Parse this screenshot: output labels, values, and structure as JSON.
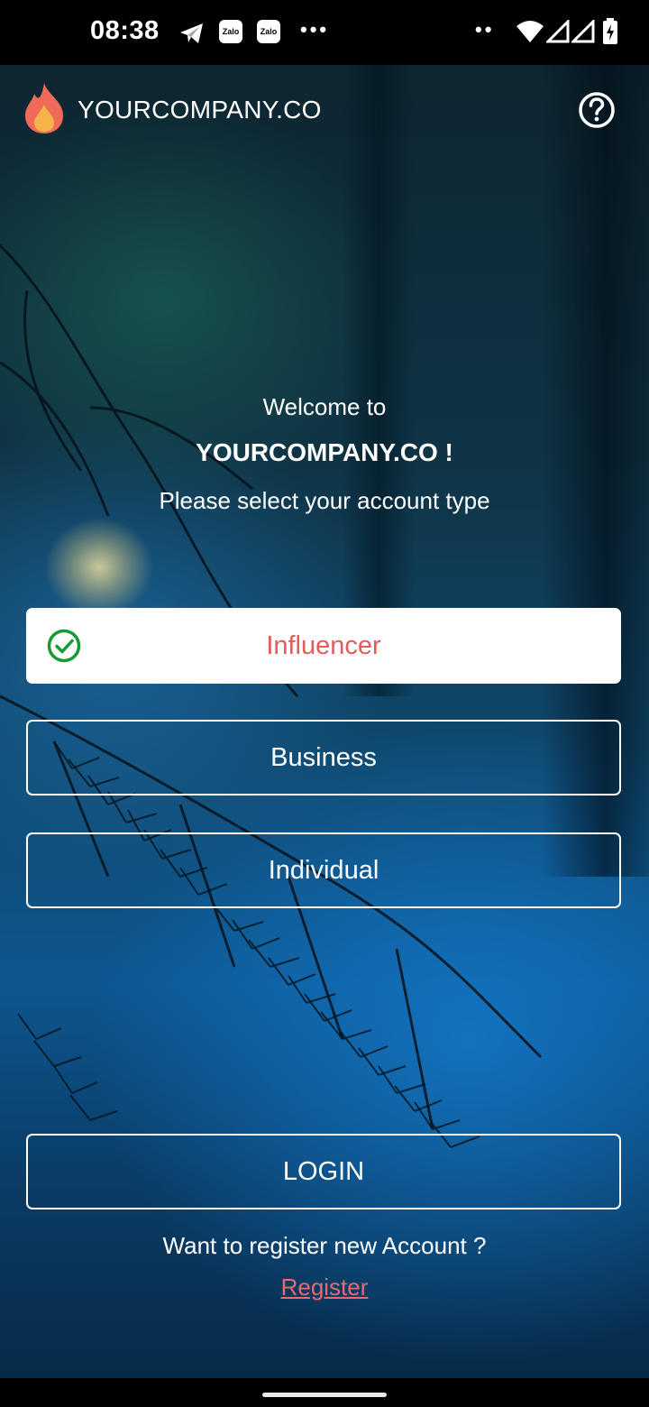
{
  "status_bar": {
    "time": "08:38",
    "notification_icons": [
      "telegram-icon",
      "zalo-icon",
      "zalo-icon",
      "more-dots-icon"
    ],
    "zalo_label": "Zalo",
    "system_icons": [
      "more-dots-icon",
      "wifi-icon",
      "signal-icon",
      "signal-icon",
      "battery-charging-icon"
    ]
  },
  "header": {
    "brand": "YOURCOMPANY.CO",
    "logo_icon": "flame-icon",
    "help_icon": "help-circle-icon"
  },
  "welcome": {
    "line1": "Welcome to",
    "line2": "YOURCOMPANY.CO !",
    "line3": "Please select your account type"
  },
  "account_types": [
    {
      "label": "Influencer",
      "selected": true
    },
    {
      "label": "Business",
      "selected": false
    },
    {
      "label": "Individual",
      "selected": false
    }
  ],
  "login_label": "LOGIN",
  "register_prompt": "Want to register new Account ?",
  "register_link": "Register",
  "colors": {
    "accent_red": "#e35b5b",
    "check_green": "#1a9a35",
    "flame_outer": "#f06a5a",
    "flame_inner": "#f7b24a"
  }
}
